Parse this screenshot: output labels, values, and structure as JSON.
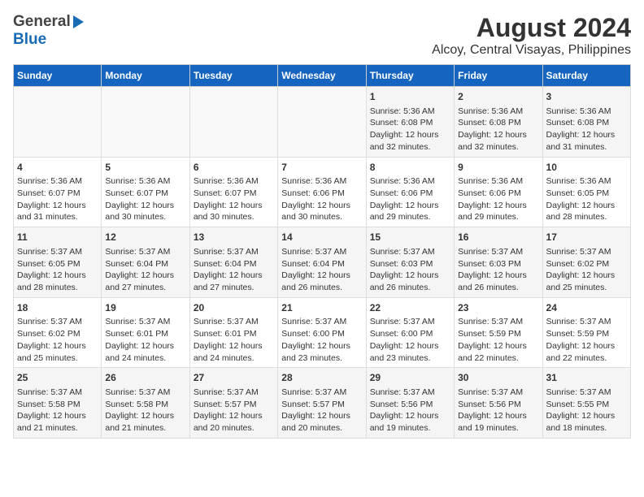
{
  "logo": {
    "general": "General",
    "blue": "Blue"
  },
  "title": "August 2024",
  "subtitle": "Alcoy, Central Visayas, Philippines",
  "days": [
    "Sunday",
    "Monday",
    "Tuesday",
    "Wednesday",
    "Thursday",
    "Friday",
    "Saturday"
  ],
  "weeks": [
    [
      {
        "num": "",
        "info": ""
      },
      {
        "num": "",
        "info": ""
      },
      {
        "num": "",
        "info": ""
      },
      {
        "num": "",
        "info": ""
      },
      {
        "num": "1",
        "info": "Sunrise: 5:36 AM\nSunset: 6:08 PM\nDaylight: 12 hours\nand 32 minutes."
      },
      {
        "num": "2",
        "info": "Sunrise: 5:36 AM\nSunset: 6:08 PM\nDaylight: 12 hours\nand 32 minutes."
      },
      {
        "num": "3",
        "info": "Sunrise: 5:36 AM\nSunset: 6:08 PM\nDaylight: 12 hours\nand 31 minutes."
      }
    ],
    [
      {
        "num": "4",
        "info": "Sunrise: 5:36 AM\nSunset: 6:07 PM\nDaylight: 12 hours\nand 31 minutes."
      },
      {
        "num": "5",
        "info": "Sunrise: 5:36 AM\nSunset: 6:07 PM\nDaylight: 12 hours\nand 30 minutes."
      },
      {
        "num": "6",
        "info": "Sunrise: 5:36 AM\nSunset: 6:07 PM\nDaylight: 12 hours\nand 30 minutes."
      },
      {
        "num": "7",
        "info": "Sunrise: 5:36 AM\nSunset: 6:06 PM\nDaylight: 12 hours\nand 30 minutes."
      },
      {
        "num": "8",
        "info": "Sunrise: 5:36 AM\nSunset: 6:06 PM\nDaylight: 12 hours\nand 29 minutes."
      },
      {
        "num": "9",
        "info": "Sunrise: 5:36 AM\nSunset: 6:06 PM\nDaylight: 12 hours\nand 29 minutes."
      },
      {
        "num": "10",
        "info": "Sunrise: 5:36 AM\nSunset: 6:05 PM\nDaylight: 12 hours\nand 28 minutes."
      }
    ],
    [
      {
        "num": "11",
        "info": "Sunrise: 5:37 AM\nSunset: 6:05 PM\nDaylight: 12 hours\nand 28 minutes."
      },
      {
        "num": "12",
        "info": "Sunrise: 5:37 AM\nSunset: 6:04 PM\nDaylight: 12 hours\nand 27 minutes."
      },
      {
        "num": "13",
        "info": "Sunrise: 5:37 AM\nSunset: 6:04 PM\nDaylight: 12 hours\nand 27 minutes."
      },
      {
        "num": "14",
        "info": "Sunrise: 5:37 AM\nSunset: 6:04 PM\nDaylight: 12 hours\nand 26 minutes."
      },
      {
        "num": "15",
        "info": "Sunrise: 5:37 AM\nSunset: 6:03 PM\nDaylight: 12 hours\nand 26 minutes."
      },
      {
        "num": "16",
        "info": "Sunrise: 5:37 AM\nSunset: 6:03 PM\nDaylight: 12 hours\nand 26 minutes."
      },
      {
        "num": "17",
        "info": "Sunrise: 5:37 AM\nSunset: 6:02 PM\nDaylight: 12 hours\nand 25 minutes."
      }
    ],
    [
      {
        "num": "18",
        "info": "Sunrise: 5:37 AM\nSunset: 6:02 PM\nDaylight: 12 hours\nand 25 minutes."
      },
      {
        "num": "19",
        "info": "Sunrise: 5:37 AM\nSunset: 6:01 PM\nDaylight: 12 hours\nand 24 minutes."
      },
      {
        "num": "20",
        "info": "Sunrise: 5:37 AM\nSunset: 6:01 PM\nDaylight: 12 hours\nand 24 minutes."
      },
      {
        "num": "21",
        "info": "Sunrise: 5:37 AM\nSunset: 6:00 PM\nDaylight: 12 hours\nand 23 minutes."
      },
      {
        "num": "22",
        "info": "Sunrise: 5:37 AM\nSunset: 6:00 PM\nDaylight: 12 hours\nand 23 minutes."
      },
      {
        "num": "23",
        "info": "Sunrise: 5:37 AM\nSunset: 5:59 PM\nDaylight: 12 hours\nand 22 minutes."
      },
      {
        "num": "24",
        "info": "Sunrise: 5:37 AM\nSunset: 5:59 PM\nDaylight: 12 hours\nand 22 minutes."
      }
    ],
    [
      {
        "num": "25",
        "info": "Sunrise: 5:37 AM\nSunset: 5:58 PM\nDaylight: 12 hours\nand 21 minutes."
      },
      {
        "num": "26",
        "info": "Sunrise: 5:37 AM\nSunset: 5:58 PM\nDaylight: 12 hours\nand 21 minutes."
      },
      {
        "num": "27",
        "info": "Sunrise: 5:37 AM\nSunset: 5:57 PM\nDaylight: 12 hours\nand 20 minutes."
      },
      {
        "num": "28",
        "info": "Sunrise: 5:37 AM\nSunset: 5:57 PM\nDaylight: 12 hours\nand 20 minutes."
      },
      {
        "num": "29",
        "info": "Sunrise: 5:37 AM\nSunset: 5:56 PM\nDaylight: 12 hours\nand 19 minutes."
      },
      {
        "num": "30",
        "info": "Sunrise: 5:37 AM\nSunset: 5:56 PM\nDaylight: 12 hours\nand 19 minutes."
      },
      {
        "num": "31",
        "info": "Sunrise: 5:37 AM\nSunset: 5:55 PM\nDaylight: 12 hours\nand 18 minutes."
      }
    ]
  ]
}
